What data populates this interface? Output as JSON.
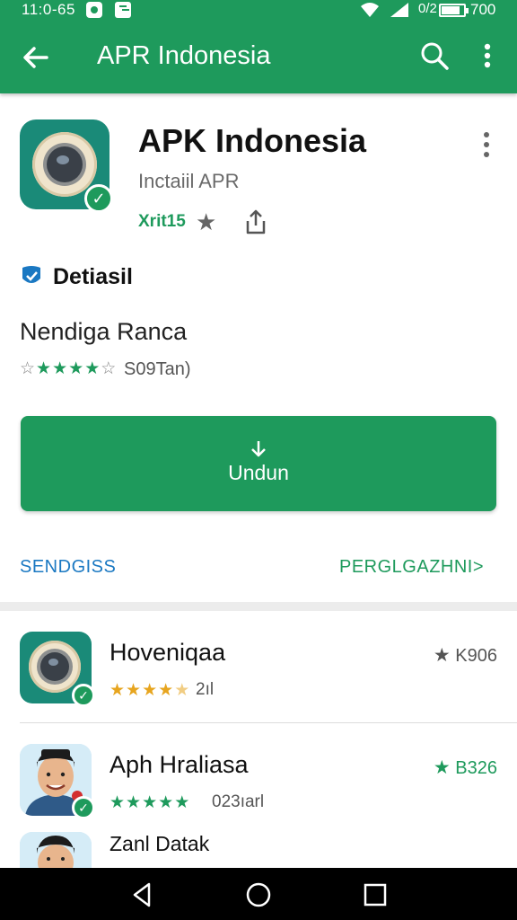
{
  "status_bar": {
    "time": "11:0-65",
    "battery_label": "0/2",
    "battery_level": 0.85,
    "battery_pct": "700"
  },
  "app_bar": {
    "title": "APR Indonesia",
    "icons": [
      "back-arrow-icon",
      "search-icon",
      "more-vert-icon"
    ]
  },
  "header": {
    "app_name": "APK Indonesia",
    "subtitle": "Inctaiil APR",
    "rating_text": "Xrit15",
    "icons": [
      "camera-app-icon",
      "verified-check-icon",
      "star-icon",
      "share-icon",
      "more-vert-icon"
    ]
  },
  "details": {
    "heading": "Detiasil",
    "item_name": "Nendiga Ranca",
    "stars": 4,
    "star_max": 5,
    "count": "S09Tan)"
  },
  "download": {
    "label": "Undun",
    "icon": "download-arrow-icon"
  },
  "links": {
    "left": "SENDGISS",
    "right": "PERGLGAZHNI>"
  },
  "list": [
    {
      "name": "Hoveniqaa",
      "stars": 4.5,
      "count": "2ıl",
      "right_label": "K906",
      "right_color": "#555555",
      "star_color": "#e7a51f",
      "icon": "camera-app-icon"
    },
    {
      "name": "Aph Hraliasa",
      "stars": 5,
      "count": "023ıarl",
      "right_label": "B326",
      "right_color": "#1e9a5c",
      "star_color": "#1e9a5c",
      "icon": "person-avatar-icon"
    },
    {
      "name": "Zanl Datak",
      "icon": "person-avatar-icon"
    }
  ],
  "colors": {
    "primary": "#1e9a5c",
    "link_blue": "#1a78c2",
    "star_gold": "#e7a51f"
  },
  "nav_icons": [
    "back-triangle-icon",
    "home-circle-icon",
    "recents-square-icon"
  ]
}
